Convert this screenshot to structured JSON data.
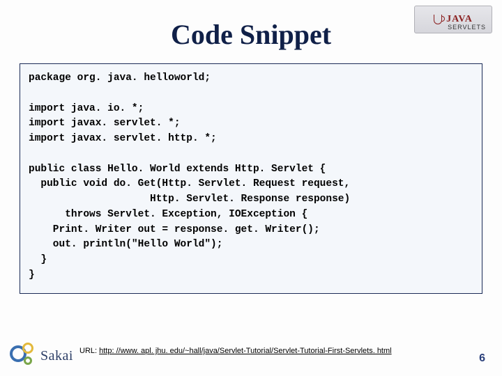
{
  "header": {
    "logo": {
      "brand": "JAVA",
      "subtitle": "SERVLETS"
    }
  },
  "title": "Code Snippet",
  "code": "package org. java. helloworld;\n\nimport java. io. *;\nimport javax. servlet. *;\nimport javax. servlet. http. *;\n\npublic class Hello. World extends Http. Servlet {\n  public void do. Get(Http. Servlet. Request request,\n                    Http. Servlet. Response response)\n      throws Servlet. Exception, IOException {\n    Print. Writer out = response. get. Writer();\n    out. println(\"Hello World\");\n  }\n}",
  "footer": {
    "sakai": "Sakai",
    "url_label": "URL: ",
    "url": "http: //www. apl. jhu. edu/~hall/java/Servlet-Tutorial/Servlet-Tutorial-First-Servlets. html",
    "page_number": "6"
  }
}
